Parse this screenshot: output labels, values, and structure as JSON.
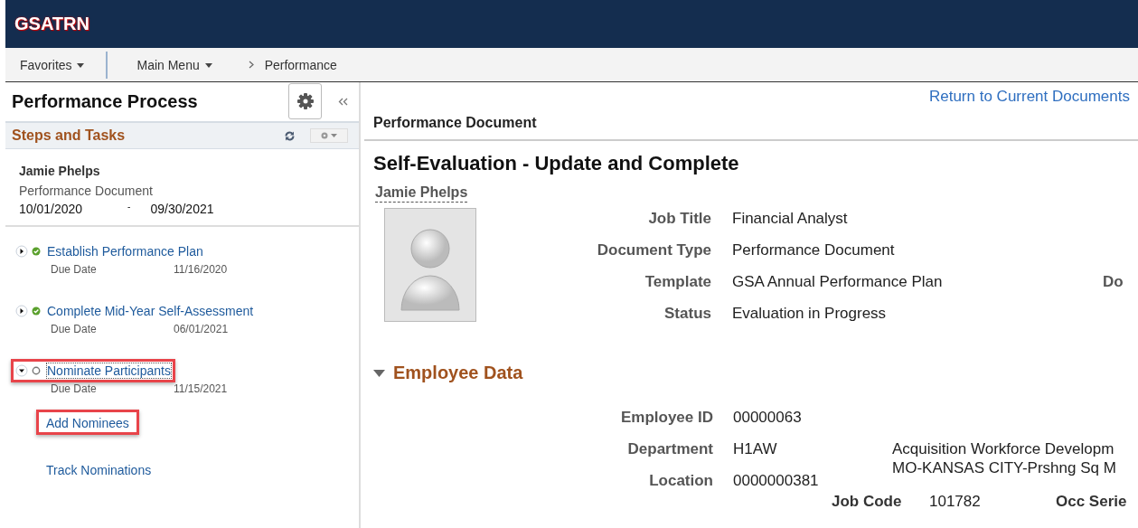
{
  "header": {
    "title": "GSATRN"
  },
  "nav": {
    "favorites": "Favorites",
    "main_menu": "Main Menu",
    "breadcrumb": "Performance"
  },
  "sidebar": {
    "title": "Performance Process",
    "section": "Steps and Tasks",
    "person": {
      "name": "Jamie Phelps",
      "document": "Performance Document",
      "start": "10/01/2020",
      "separator": "-",
      "end": "09/30/2021"
    },
    "tasks": [
      {
        "label": "Establish Performance Plan",
        "due_label": "Due Date",
        "due": "11/16/2020",
        "expanded": false,
        "completed": true,
        "highlighted": false
      },
      {
        "label": "Complete Mid-Year Self-Assessment",
        "due_label": "Due Date",
        "due": "06/01/2021",
        "expanded": false,
        "completed": true,
        "highlighted": false
      },
      {
        "label": "Nominate Participants",
        "due_label": "Due Date",
        "due": "11/15/2021",
        "expanded": true,
        "completed": false,
        "highlighted": true,
        "children": [
          {
            "label": "Add Nominees",
            "highlighted": true
          },
          {
            "label": "Track Nominations",
            "highlighted": false
          }
        ]
      }
    ]
  },
  "main": {
    "return_link": "Return to Current Documents",
    "section_title": "Performance Document",
    "heading": "Self-Evaluation - Update and Complete",
    "person": "Jamie Phelps",
    "fields": [
      {
        "label": "Job Title",
        "value": "Financial Analyst"
      },
      {
        "label": "Document Type",
        "value": "Performance Document"
      },
      {
        "label": "Template",
        "value": "GSA Annual Performance Plan",
        "extra": "Do"
      },
      {
        "label": "Status",
        "value": "Evaluation in Progress"
      }
    ],
    "employee_section": "Employee Data",
    "employee_fields": [
      {
        "label": "Employee ID",
        "value": "00000063"
      },
      {
        "label": "Department",
        "value": "H1AW",
        "extra": "Acquisition Workforce Developm"
      },
      {
        "label": "Location",
        "value": "0000000381",
        "extra": "MO-KANSAS CITY-Prshng Sq M"
      }
    ],
    "job_code": {
      "label": "Job Code",
      "value": "101782",
      "extra_label": "Occ Serie"
    }
  }
}
